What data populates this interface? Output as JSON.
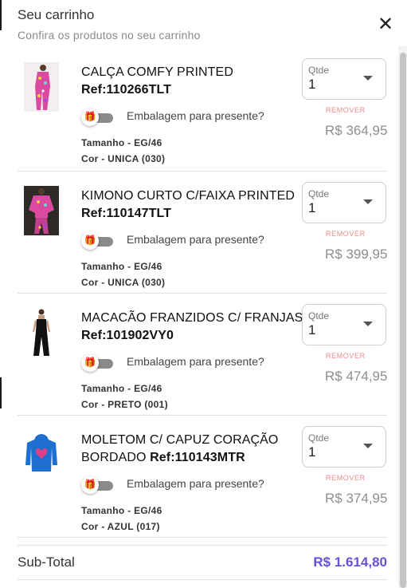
{
  "header": {
    "title": "Seu carrinho",
    "subtitle": "Confira os produtos no seu carrinho",
    "close_icon": "close-icon"
  },
  "items": [
    {
      "name": "CALÇA COMFY PRINTED",
      "ref": "Ref:110266TLT",
      "gift_label": "Embalagem para presente?",
      "size": "Tamanho - EG/46",
      "color": "Cor - UNICA (030)",
      "qty_label": "Qtde",
      "qty": "1",
      "remove": "REMOVER",
      "price": "R$ 364,95",
      "thumb": "pink-printed-pants-image"
    },
    {
      "name": "KIMONO CURTO C/FAIXA PRINTED",
      "ref": "Ref:110147TLT",
      "gift_label": "Embalagem para presente?",
      "size": "Tamanho - EG/46",
      "color": "Cor - UNICA (030)",
      "qty_label": "Qtde",
      "qty": "1",
      "remove": "REMOVER",
      "price": "R$ 399,95",
      "thumb": "printed-kimono-image"
    },
    {
      "name": "MACACÃO FRANZIDOS C/ FRANJAS",
      "ref": "Ref:101902VY0",
      "gift_label": "Embalagem para presente?",
      "size": "Tamanho - EG/46",
      "color": "Cor - PRETO (001)",
      "qty_label": "Qtde",
      "qty": "1",
      "remove": "REMOVER",
      "price": "R$ 474,95",
      "thumb": "black-jumpsuit-image"
    },
    {
      "name": "MOLETOM C/ CAPUZ CORAÇÃO BORDADO",
      "ref": "Ref:110143MTR",
      "gift_label": "Embalagem para presente?",
      "size": "Tamanho - EG/46",
      "color": "Cor - AZUL (017)",
      "qty_label": "Qtde",
      "qty": "1",
      "remove": "REMOVER",
      "price": "R$ 374,95",
      "thumb": "blue-heart-hoodie-image"
    }
  ],
  "summary": {
    "subtotal_label": "Sub-Total",
    "subtotal_value": "R$ 1.614,80"
  },
  "colors": {
    "accent": "#6a4fd6",
    "remove": "#f08a8a",
    "price": "#8e8e8e"
  }
}
